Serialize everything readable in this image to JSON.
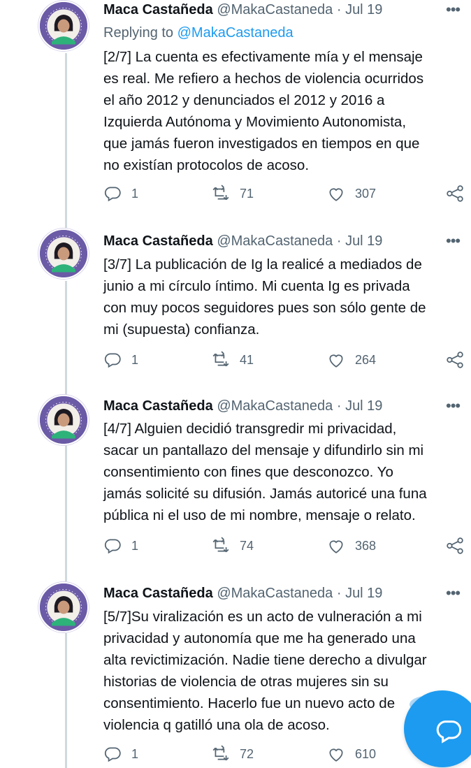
{
  "colors": {
    "accent": "#1d9bf0",
    "text": "#0f1419",
    "muted": "#536471",
    "thread": "#cfd9de"
  },
  "tweets": [
    {
      "name": "Maca Castañeda",
      "handle": "@MakaCastaneda",
      "dot": "·",
      "date": "Jul 19",
      "more": "•••",
      "replying_prefix": "Replying to ",
      "replying_to": "@MakaCastaneda",
      "text": "[2/7] La cuenta es efectivamente mía y el mensaje\nes real. Me refiero a hechos de violencia ocurridos\nel año 2012 y denunciados el 2012 y 2016 a\nIzquierda Autónoma y Movimiento Autonomista,\nque jamás fueron investigados en tiempos en que\nno existían protocolos de acoso.",
      "replies": "1",
      "retweets": "71",
      "likes": "307"
    },
    {
      "name": "Maca Castañeda",
      "handle": "@MakaCastaneda",
      "dot": "·",
      "date": "Jul 19",
      "more": "•••",
      "text": "[3/7] La publicación de Ig la realicé a mediados de\njunio a mi círculo íntimo. Mi cuenta Ig es privada\ncon muy pocos seguidores pues son sólo gente de\nmi (supuesta) confianza.",
      "replies": "1",
      "retweets": "41",
      "likes": "264"
    },
    {
      "name": "Maca Castañeda",
      "handle": "@MakaCastaneda",
      "dot": "·",
      "date": "Jul 19",
      "more": "•••",
      "text": "[4/7] Alguien decidió transgredir mi privacidad,\nsacar un pantallazo del mensaje y difundirlo sin mi\nconsentimiento con fines que desconozco. Yo\njamás solicité su difusión. Jamás autoricé una funa\npública ni el uso de mi nombre, mensaje o relato.",
      "replies": "1",
      "retweets": "74",
      "likes": "368"
    },
    {
      "name": "Maca Castañeda",
      "handle": "@MakaCastaneda",
      "dot": "·",
      "date": "Jul 19",
      "more": "•••",
      "text": "[5/7]Su viralización es un acto de vulneración a mi\nprivacidad y autonomía que me ha generado una\nalta revictimización. Nadie tiene derecho a divulgar\nhistorias de violencia de otras mujeres sin su\nconsentimiento. Hacerlo fue un nuevo acto de\nviolencia q gatilló una ola de acoso.",
      "replies": "1",
      "retweets": "72",
      "likes": "610"
    }
  ],
  "icons": {
    "reply": "reply-icon",
    "retweet": "retweet-icon",
    "like": "heart-icon",
    "share": "share-icon",
    "compose": "compose-reply-icon"
  }
}
